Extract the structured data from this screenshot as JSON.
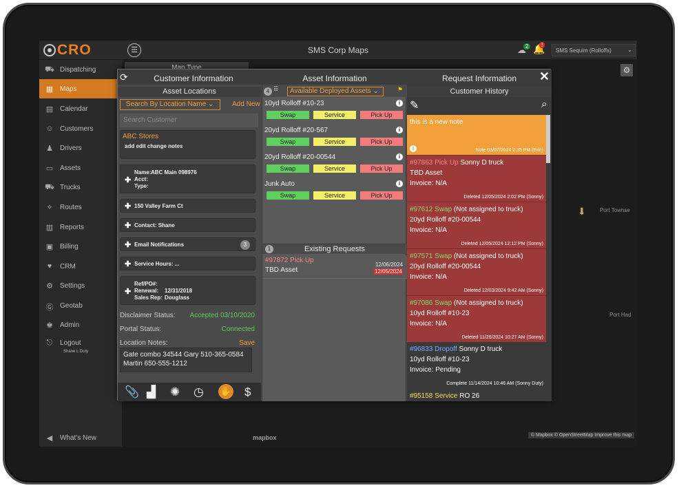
{
  "app": {
    "logo_text": "CRO",
    "title": "SMS Corp Maps",
    "cloud_count": "2",
    "bell_count": "!",
    "account": "SMS Sequim (Rolloffs)"
  },
  "sidebar": {
    "items": [
      {
        "label": "Dispatching",
        "icon": "dispatch-icon"
      },
      {
        "label": "Maps",
        "icon": "map-icon",
        "active": true
      },
      {
        "label": "Calendar",
        "icon": "calendar-icon"
      },
      {
        "label": "Customers",
        "icon": "customers-icon"
      },
      {
        "label": "Drivers",
        "icon": "driver-icon"
      },
      {
        "label": "Assets",
        "icon": "assets-icon"
      },
      {
        "label": "Trucks",
        "icon": "truck-icon"
      },
      {
        "label": "Routes",
        "icon": "routes-icon"
      },
      {
        "label": "Reports",
        "icon": "reports-icon"
      },
      {
        "label": "Billing",
        "icon": "billing-icon"
      },
      {
        "label": "CRM",
        "icon": "crm-icon"
      },
      {
        "label": "Settings",
        "icon": "settings-icon"
      },
      {
        "label": "Geotab",
        "icon": "geotab-icon"
      },
      {
        "label": "Admin",
        "icon": "admin-icon"
      },
      {
        "label": "Logout",
        "icon": "logout-icon"
      }
    ],
    "logout_user": "Shane L Duty",
    "whats_new": "What's New"
  },
  "map": {
    "map_type": "Map Type",
    "place1": "Port Townse",
    "place2": "Port Had",
    "mapbox_logo": "mapbox",
    "attribution": "© Mapbox © OpenStreetMap Improve this map"
  },
  "modal": {
    "headers": {
      "customer": "Customer Information",
      "asset": "Asset Information",
      "request": "Request Information"
    },
    "customer": {
      "subheader": "Asset Locations",
      "search_by": "Search By Location Name",
      "add_new": "Add New",
      "search_placeholder": "Search Customer",
      "store_name": "ABC Stores",
      "store_note": "add edit change notes",
      "loc_name_label": "Name:",
      "loc_name": "ABC Main 098976",
      "acct_label": "Acct:",
      "type_label": "Type:",
      "address": "150 Valley Farm Ct",
      "contact_label": "Contact:",
      "contact": "Shane",
      "email_notif": "Email Notifications",
      "email_count": "3",
      "service_hours_label": "Service Hours:",
      "service_hours": "...",
      "refpo_label": "Ref/PO#:",
      "renewal_label": "Renewal:",
      "renewal": "12/31/2018",
      "salesrep_label": "Sales Rep:",
      "salesrep": "Douglass",
      "disclaimer_label": "Disclaimer Status:",
      "disclaimer_value": "Accepted 03/10/2020",
      "portal_label": "Portal Status:",
      "portal_value": "Connected",
      "loc_notes_label": "Location Notes:",
      "save": "Save",
      "notes_text": "Gate combo 34544 Gary 510-365-0584 Martin 650-555-1212"
    },
    "asset": {
      "count": "4",
      "filter": "Available Deployed Assets",
      "assets": [
        {
          "name": "10yd Rolloff #10-23"
        },
        {
          "name": "20yd Rolloff #20-567"
        },
        {
          "name": "20yd Rolloff #20-00544"
        },
        {
          "name": "Junk Auto"
        }
      ],
      "btn_swap": "Swap",
      "btn_service": "Service",
      "btn_pickup": "Pick Up",
      "existing_count": "1",
      "existing_title": "Existing Requests",
      "request": {
        "id": "#97872 Pick Up",
        "asset": "TBD Asset",
        "date1": "12/06/2024",
        "date2": "12/05/2024"
      }
    },
    "request": {
      "subheader": "Customer History",
      "note_text": "this is a new note",
      "note_footer": "Note 03/07/2024 2:35 PM (Eric)",
      "history": [
        {
          "id": "#97863 Pick Up",
          "rest": " Sonny D truck",
          "line2": "TBD Asset",
          "line3": "Invoice: N/A",
          "footer": "Deleted 12/05/2024 2:02 PM (Sonny)"
        },
        {
          "id": "#97612 Swap",
          "rest": " (Not assigned to truck)",
          "line2": "20yd Rolloff #20-00544",
          "line3": "Invoice: N/A",
          "footer": "Deleted 12/05/2024 12:12 PM (Sonny)"
        },
        {
          "id": "#97571 Swap",
          "rest": " (Not assigned to truck)",
          "line2": "20yd Rolloff #20-00544",
          "line3": "Invoice: N/A",
          "footer": "Deleted 12/03/2024 9:42 AM (Sonny)"
        },
        {
          "id": "#97086 Swap",
          "rest": " (Not assigned to truck)",
          "line2": "10yd Rolloff #10-23",
          "line3": "Invoice: N/A",
          "footer": "Deleted 11/26/2024 10:27 AM (Sonny)"
        },
        {
          "id": "#96833 Dropoff",
          "rest": " Sonny D truck",
          "line2": "10yd Rolloff #10-23",
          "line3": "Invoice: Pending",
          "footer": "Complete 11/14/2024 10:46 AM (Sonny Duty)"
        },
        {
          "id": "#95158 Service",
          "rest": " RO 26"
        }
      ]
    }
  }
}
